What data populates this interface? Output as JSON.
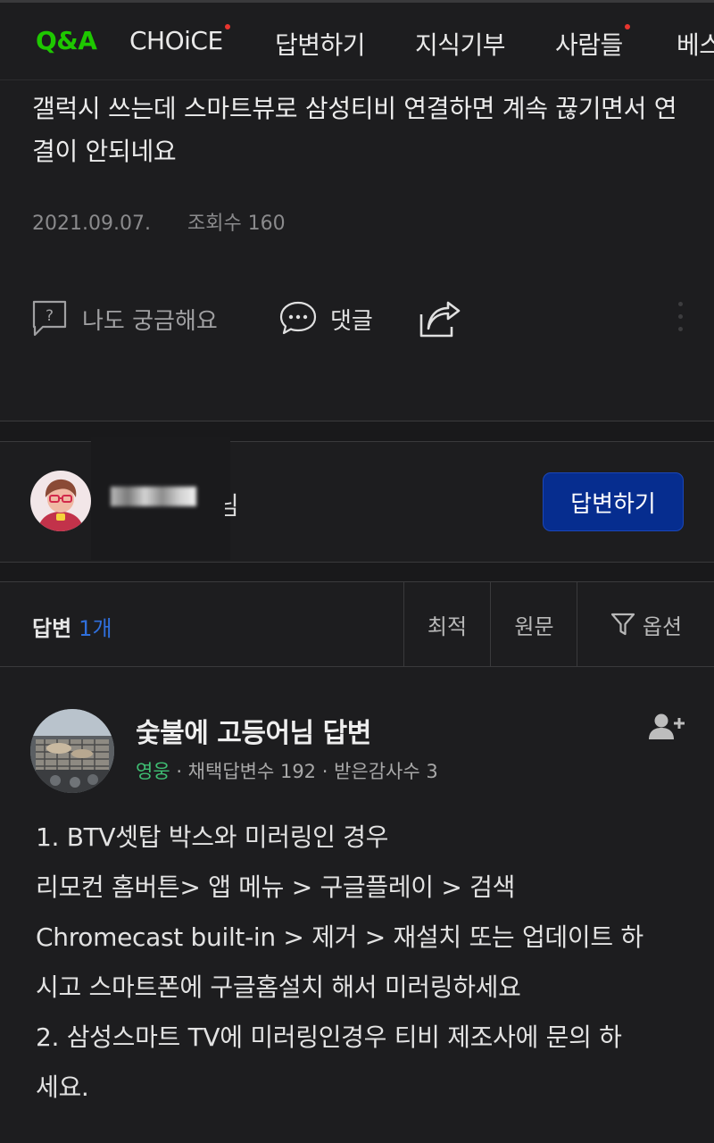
{
  "nav": {
    "tabs": [
      {
        "label": "Q&A",
        "active": true
      },
      {
        "label": "CHOiCE",
        "badge": true
      },
      {
        "label": "답변하기"
      },
      {
        "label": "지식기부"
      },
      {
        "label": "사람들",
        "badge": true
      },
      {
        "label": "베스"
      }
    ]
  },
  "question": {
    "title": "갤럭시 쓰는데 스마트뷰로 삼성티비 연결하면 계속 끊기면서 연결이 안되네요",
    "date": "2021.09.07.",
    "views": "조회수 160"
  },
  "actions": {
    "curious": "나도 궁금해요",
    "comment": "댓글"
  },
  "my_answer_bar": {
    "name_tail": "님",
    "button": "답변하기"
  },
  "answers_header": {
    "label": "답변",
    "count": "1개",
    "sort_options": [
      "최적",
      "원문"
    ],
    "options_label": "옵션"
  },
  "answer": {
    "author": "숯불에 고등어님 답변",
    "grade": "영웅",
    "adopted": "· 채택답변수 192",
    "thanks": "· 받은감사수 3",
    "lines": [
      "1. BTV셋탑 박스와 미러링인 경우",
      "리모컨  홈버튼> 앱 메뉴 > 구글플레이 > 검색",
      "Chromecast built-in > 제거 > 재설치 또는 업데이트 하",
      "시고 스마트폰에 구글홈설치 해서 미러링하세요",
      "2. 삼성스마트 TV에 미러링인경우 티비 제조사에 문의 하",
      "세요."
    ]
  },
  "colors": {
    "background": "#1d1d1f",
    "active_tab": "#1ec800",
    "badge": "#e8352f",
    "primary_button": "#062d8f",
    "count_accent": "#2f6fdc",
    "grade_green": "#3fbf73"
  },
  "icons": [
    "question-box-icon",
    "speech-bubble-icon",
    "share-icon",
    "more-vertical-icon",
    "filter-icon",
    "add-person-icon"
  ]
}
